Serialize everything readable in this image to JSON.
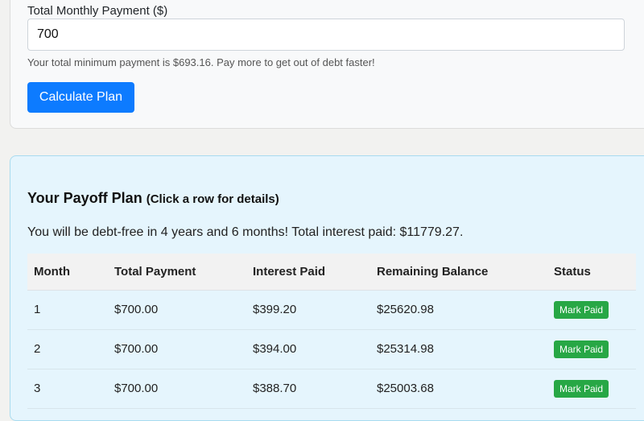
{
  "form": {
    "payment_label": "Total Monthly Payment ($)",
    "payment_value": "700",
    "hint": "Your total minimum payment is $693.16. Pay more to get out of debt faster!",
    "calculate_label": "Calculate Plan"
  },
  "plan": {
    "title": "Your Payoff Plan",
    "subtitle": "(Click a row for details)",
    "summary": "You will be debt-free in 4 years and 6 months! Total interest paid: $11779.27.",
    "columns": [
      "Month",
      "Total Payment",
      "Interest Paid",
      "Remaining Balance",
      "Status"
    ],
    "rows": [
      {
        "month": "1",
        "total": "$700.00",
        "interest": "$399.20",
        "balance": "$25620.98",
        "status": "Mark Paid"
      },
      {
        "month": "2",
        "total": "$700.00",
        "interest": "$394.00",
        "balance": "$25314.98",
        "status": "Mark Paid"
      },
      {
        "month": "3",
        "total": "$700.00",
        "interest": "$388.70",
        "balance": "$25003.68",
        "status": "Mark Paid"
      }
    ]
  },
  "colors": {
    "primary": "#0d7bff",
    "success": "#27a745",
    "plan_background": "#e5f5fd"
  }
}
